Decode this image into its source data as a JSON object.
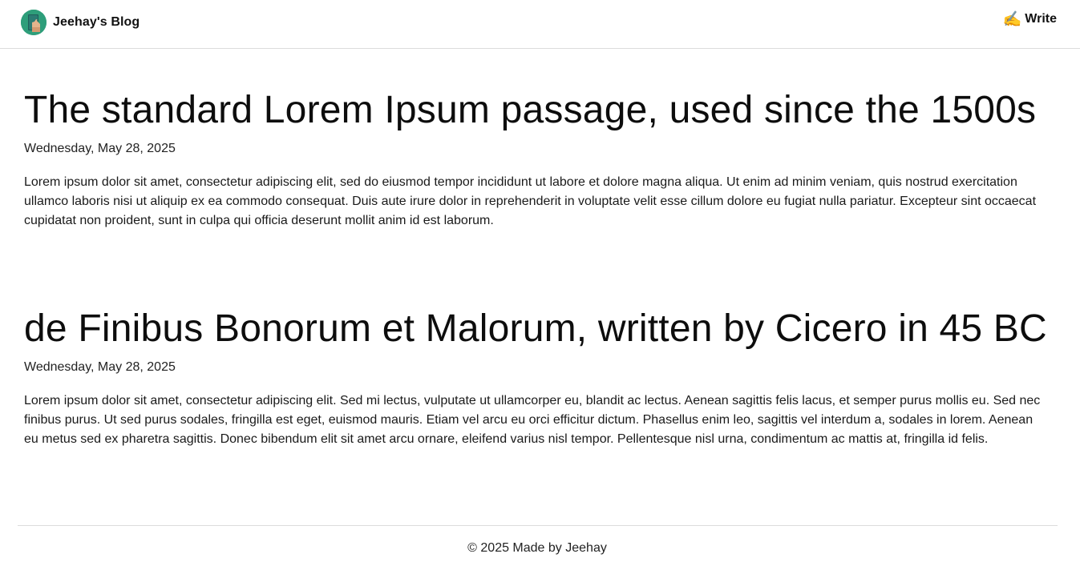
{
  "header": {
    "brand_name": "Jeehay's Blog",
    "avatar_icon": "user-avatar-icon",
    "write_icon": "✍️",
    "write_label": "Write"
  },
  "posts": [
    {
      "title": "The standard Lorem Ipsum passage, used since the 1500s",
      "date": "Wednesday, May 28, 2025",
      "body": "Lorem ipsum dolor sit amet, consectetur adipiscing elit, sed do eiusmod tempor incididunt ut labore et dolore magna aliqua. Ut enim ad minim veniam, quis nostrud exercitation ullamco laboris nisi ut aliquip ex ea commodo consequat. Duis aute irure dolor in reprehenderit in voluptate velit esse cillum dolore eu fugiat nulla pariatur. Excepteur sint occaecat cupidatat non proident, sunt in culpa qui officia deserunt mollit anim id est laborum."
    },
    {
      "title": "de Finibus Bonorum et Malorum, written by Cicero in 45 BC",
      "date": "Wednesday, May 28, 2025",
      "body": "Lorem ipsum dolor sit amet, consectetur adipiscing elit. Sed mi lectus, vulputate ut ullamcorper eu, blandit ac lectus. Aenean sagittis felis lacus, et semper purus mollis eu. Sed nec finibus purus. Ut sed purus sodales, fringilla est eget, euismod mauris. Etiam vel arcu eu orci efficitur dictum. Phasellus enim leo, sagittis vel interdum a, sodales in lorem. Aenean eu metus sed ex pharetra sagittis. Donec bibendum elit sit amet arcu ornare, eleifend varius nisl tempor. Pellentesque nisl urna, condimentum ac mattis at, fringilla id felis."
    }
  ],
  "footer": {
    "text": "© 2025 Made by Jeehay"
  },
  "colors": {
    "avatar_bg": "#2e9e7a",
    "divider": "#dcdcdc",
    "text": "#111111"
  }
}
